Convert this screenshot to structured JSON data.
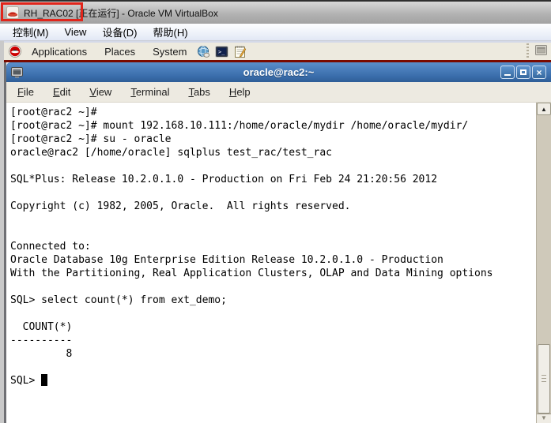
{
  "vbox_window": {
    "title": "RH_RAC02 [正在运行] - Oracle VM VirtualBox",
    "menu_items": [
      "控制(M)",
      "View",
      "设备(D)",
      "帮助(H)"
    ]
  },
  "gnome_panel": {
    "menus": [
      "Applications",
      "Places",
      "System"
    ]
  },
  "terminal_window": {
    "title": "oracle@rac2:~",
    "menu_items": [
      "File",
      "Edit",
      "View",
      "Terminal",
      "Tabs",
      "Help"
    ],
    "content": "[root@rac2 ~]# \n[root@rac2 ~]# mount 192.168.10.111:/home/oracle/mydir /home/oracle/mydir/\n[root@rac2 ~]# su - oracle\noracle@rac2 [/home/oracle] sqlplus test_rac/test_rac\n\nSQL*Plus: Release 10.2.0.1.0 - Production on Fri Feb 24 21:20:56 2012\n\nCopyright (c) 1982, 2005, Oracle.  All rights reserved.\n\n\nConnected to: \nOracle Database 10g Enterprise Edition Release 10.2.0.1.0 - Production\nWith the Partitioning, Real Application Clusters, OLAP and Data Mining options\n\nSQL> select count(*) from ext_demo;\n\n  COUNT(*)\n----------\n         8\n\nSQL> "
  },
  "scrollbar": {
    "up_glyph": "▲",
    "down_glyph": "▼"
  },
  "window_buttons": {
    "close_glyph": "×"
  },
  "colors": {
    "annotation_red": "#e1251b",
    "terminal_titlebar_blue": "#3a6dab",
    "panel_beige": "#edeadf",
    "panel_accent_dark_red": "#7a0a00",
    "terminal_bg": "#ffffff",
    "terminal_text": "#000000"
  }
}
